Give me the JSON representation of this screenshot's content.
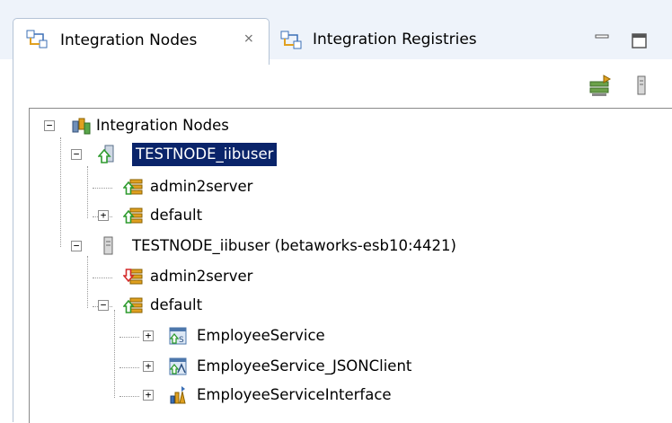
{
  "tabs": [
    {
      "label": "Integration Nodes",
      "close": "⨯"
    },
    {
      "label": "Integration Registries"
    }
  ],
  "tree": {
    "root": "Integration Nodes",
    "items": [
      {
        "label": "TESTNODE_iibuser"
      },
      {
        "label": "admin2server"
      },
      {
        "label": "default"
      },
      {
        "label": "TESTNODE_iibuser (betaworks-esb10:4421)"
      },
      {
        "label": "admin2server"
      },
      {
        "label": "default"
      },
      {
        "label": "EmployeeService"
      },
      {
        "label": "EmployeeService_JSONClient"
      },
      {
        "label": "EmployeeServiceInterface"
      }
    ]
  },
  "colors": {
    "selection": "#0a246a",
    "tab_bg": "#eef3fa",
    "running": "#2e9b2e",
    "stopped": "#d42a2a"
  }
}
